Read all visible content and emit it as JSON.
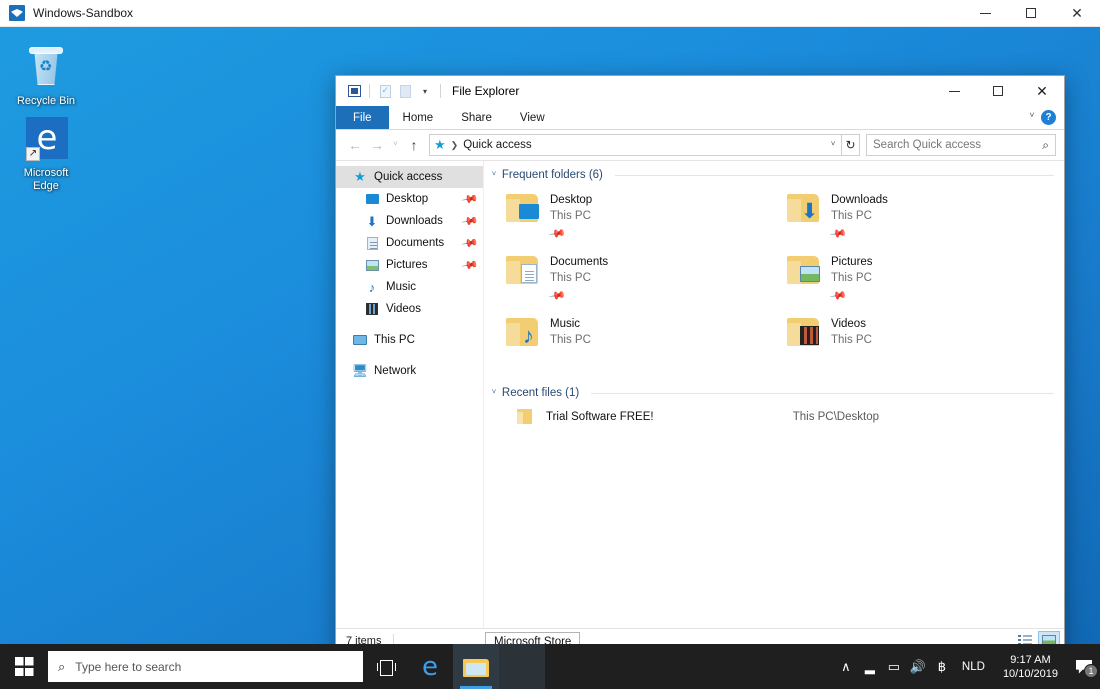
{
  "host_window": {
    "title": "Windows-Sandbox",
    "icon": "sandbox-icon",
    "minimize_label": "─",
    "maximize_label": "□",
    "close_label": "✕"
  },
  "desktop": {
    "icons": [
      {
        "label": "Recycle Bin",
        "icon": "recycle-bin-icon"
      },
      {
        "label": "Microsoft\nEdge",
        "label_line1": "Microsoft",
        "label_line2": "Edge",
        "icon": "edge-icon"
      }
    ]
  },
  "explorer": {
    "title": "File Explorer",
    "qat": [
      {
        "name": "explorer-icon"
      },
      {
        "name": "properties-icon"
      },
      {
        "name": "new-folder-icon"
      },
      {
        "name": "customize-qat-chevron-icon",
        "glyph": "▾"
      }
    ],
    "window_controls": {
      "minimize": "─",
      "maximize": "□",
      "close": "✕"
    },
    "ribbon": {
      "tabs": [
        {
          "label": "File",
          "active": true
        },
        {
          "label": "Home",
          "active": false
        },
        {
          "label": "Share",
          "active": false
        },
        {
          "label": "View",
          "active": false
        }
      ],
      "collapse_glyph": "ⱽ",
      "help_label": "?"
    },
    "addressbar": {
      "back_glyph": "←",
      "forward_glyph": "→",
      "recent_glyph": "ⱽ",
      "up_glyph": "↑",
      "star_glyph": "★",
      "breadcrumb_sep": "❯",
      "path": "Quick access",
      "dropdown_glyph": "ⱽ",
      "refresh_glyph": "↻"
    },
    "search": {
      "placeholder": "Search Quick access",
      "icon": "search-icon",
      "icon_glyph": "⌕"
    },
    "navpane": {
      "items": [
        {
          "label": "Quick access",
          "icon": "star-icon",
          "selected": true,
          "pinned": false,
          "indent": false
        },
        {
          "label": "Desktop",
          "icon": "monitor-icon",
          "selected": false,
          "pinned": true,
          "indent": true
        },
        {
          "label": "Downloads",
          "icon": "download-icon",
          "selected": false,
          "pinned": true,
          "indent": true
        },
        {
          "label": "Documents",
          "icon": "document-icon",
          "selected": false,
          "pinned": true,
          "indent": true
        },
        {
          "label": "Pictures",
          "icon": "picture-icon",
          "selected": false,
          "pinned": true,
          "indent": true
        },
        {
          "label": "Music",
          "icon": "music-note-icon",
          "selected": false,
          "pinned": false,
          "indent": true
        },
        {
          "label": "Videos",
          "icon": "film-icon",
          "selected": false,
          "pinned": false,
          "indent": true
        },
        {
          "label": "This PC",
          "icon": "computer-icon",
          "selected": false,
          "pinned": false,
          "indent": false,
          "gap_before": true
        },
        {
          "label": "Network",
          "icon": "network-icon",
          "selected": false,
          "pinned": false,
          "indent": false,
          "gap_before": true
        }
      ],
      "pin_glyph": "📌"
    },
    "frequent_folders": {
      "header": "Frequent folders (6)",
      "chevron": "ⱽ",
      "items": [
        {
          "name": "Desktop",
          "location": "This PC",
          "pinned": true,
          "overlay": "desktop-overlay-icon"
        },
        {
          "name": "Downloads",
          "location": "This PC",
          "pinned": true,
          "overlay": "download-overlay-icon"
        },
        {
          "name": "Documents",
          "location": "This PC",
          "pinned": true,
          "overlay": "document-overlay-icon"
        },
        {
          "name": "Pictures",
          "location": "This PC",
          "pinned": true,
          "overlay": "picture-overlay-icon"
        },
        {
          "name": "Music",
          "location": "This PC",
          "pinned": false,
          "overlay": "music-overlay-icon"
        },
        {
          "name": "Videos",
          "location": "This PC",
          "pinned": false,
          "overlay": "video-overlay-icon"
        }
      ]
    },
    "recent_files": {
      "header": "Recent files (1)",
      "chevron": "ⱽ",
      "items": [
        {
          "name": "Trial Software FREE!",
          "location": "This PC\\Desktop"
        }
      ]
    },
    "statusbar": {
      "item_count": "7 items",
      "view_details_icon": "details-view-icon",
      "view_tiles_icon": "large-icons-view-icon"
    }
  },
  "taskbar": {
    "start_label": "Start",
    "search_placeholder": "Type here to search",
    "search_icon_glyph": "⌕",
    "taskview_label": "Task View",
    "apps": [
      {
        "name": "Microsoft Edge",
        "icon": "edge-icon",
        "state": "idle"
      },
      {
        "name": "File Explorer",
        "icon": "folder-icon",
        "state": "active"
      },
      {
        "name": "Microsoft Store",
        "icon": "store-icon",
        "state": "hover"
      }
    ],
    "tooltip": "Microsoft Store",
    "tray": {
      "overflow_glyph": "∧",
      "icons": [
        {
          "name": "battery-icon",
          "glyph": "▂"
        },
        {
          "name": "network-icon",
          "glyph": "▭"
        },
        {
          "name": "volume-icon",
          "glyph": "🔊"
        },
        {
          "name": "bluetooth-icon",
          "glyph": "฿"
        }
      ],
      "language": "NLD",
      "time": "9:17 AM",
      "date": "10/10/2019",
      "notification_count": "1"
    }
  },
  "colors": {
    "accent": "#0078d7",
    "ribbon_file": "#1e6fba",
    "desktop_blue": "#1b8ddc",
    "taskbar": "#1f1f1f",
    "folder_yellow": "#f2cd72"
  }
}
